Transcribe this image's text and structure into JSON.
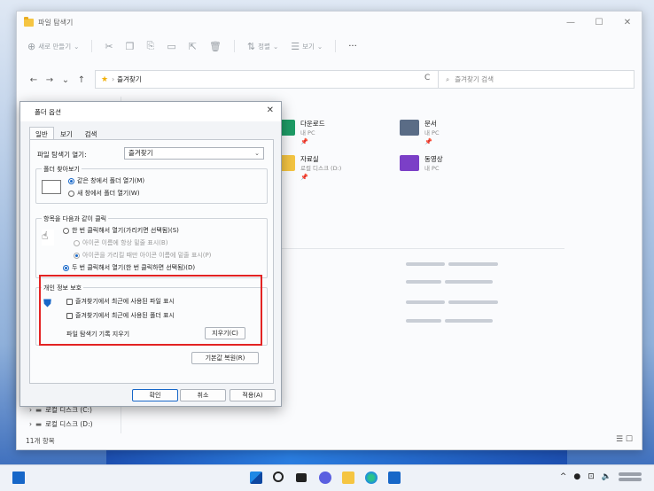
{
  "window": {
    "title": "파일 탐색기",
    "controls": [
      "—",
      "☐",
      "✕"
    ]
  },
  "toolbar": {
    "new_label": "새로 만들기",
    "sort_label": "정렬",
    "view_label": "보기",
    "more": "···"
  },
  "address": {
    "path": "즐겨찾기",
    "search_placeholder": "즐겨찾기 검색",
    "back": "←",
    "forward": "→",
    "up": "↑",
    "refresh": "C"
  },
  "quick_access": [
    {
      "name": "다운로드",
      "sub": "내 PC",
      "color": "#1e9c66"
    },
    {
      "name": "문서",
      "sub": "내 PC",
      "color": "#5a6c86"
    },
    {
      "name": "자료실",
      "sub": "로컬 디스크 (D:)",
      "color": "#f5c542"
    },
    {
      "name": "동영상",
      "sub": "내 PC",
      "color": "#7b3fc7"
    }
  ],
  "sidebar": {
    "disk": "로컬 디스크 (D:)",
    "disk_partial": "로컬 디스크 (C:)"
  },
  "status": {
    "count": "11개 항목"
  },
  "dialog": {
    "title": "폴더 옵션",
    "close": "✕",
    "tabs": [
      "일반",
      "보기",
      "검색"
    ],
    "open_label": "파일 탐색기 열기:",
    "open_value": "즐겨찾기",
    "browse_group": "폴더 찾아보기",
    "browse_same": "같은 창에서 폴더 열기(M)",
    "browse_new": "새 창에서 폴더 열기(W)",
    "click_group": "항목을 다음과 같이 클릭",
    "single_click": "한 번 클릭해서 열기(가리키면 선택됨)(S)",
    "underline_always": "아이콘 이름에 항상 밑줄 표시(B)",
    "underline_hover": "아이콘을 가리킬 때만 아이콘 이름에 밑줄 표시(P)",
    "double_click": "두 번 클릭해서 열기(한 번 클릭하면 선택됨)(D)",
    "privacy_group": "개인 정보 보호",
    "recent_files": "즐겨찾기에서 최근에 사용된 파일 표시",
    "frequent_folders": "즐겨찾기에서 최근에 사용된 폴더 표시",
    "clear_history_label": "파일 탐색기 기록 지우기",
    "clear_button": "지우기(C)",
    "restore_button": "기본값 복원(R)",
    "ok": "확인",
    "cancel": "취소",
    "apply": "적용(A)"
  },
  "colors": {
    "highlight_box": "#e32323",
    "accent": "#1767c8"
  }
}
